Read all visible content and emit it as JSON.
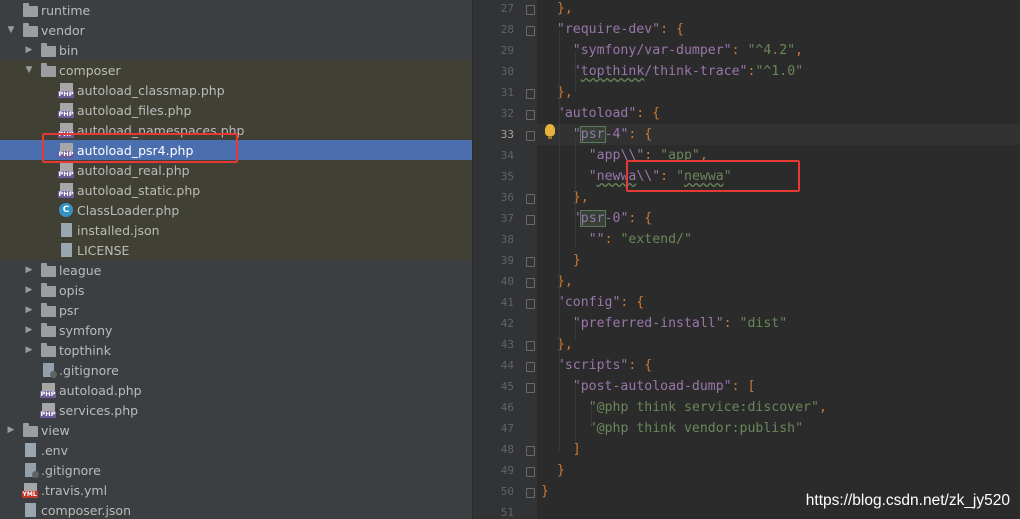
{
  "project_tree": {
    "items": [
      {
        "label": "runtime",
        "icon": "folder-icon",
        "expand": "none",
        "selected": false
      },
      {
        "label": "vendor",
        "icon": "folder-icon",
        "expand": "open",
        "selected": false
      },
      {
        "label": "bin",
        "icon": "folder-icon",
        "expand": "closed",
        "selected": false
      },
      {
        "label": "composer",
        "icon": "folder-icon",
        "expand": "open",
        "selected": false
      },
      {
        "label": "autoload_classmap.php",
        "icon": "php-file-icon",
        "expand": "none",
        "selected": false
      },
      {
        "label": "autoload_files.php",
        "icon": "php-file-icon",
        "expand": "none",
        "selected": false
      },
      {
        "label": "autoload_namespaces.php",
        "icon": "php-file-icon",
        "expand": "none",
        "selected": false
      },
      {
        "label": "autoload_psr4.php",
        "icon": "php-file-icon",
        "expand": "none",
        "selected": true
      },
      {
        "label": "autoload_real.php",
        "icon": "php-file-icon",
        "expand": "none",
        "selected": false
      },
      {
        "label": "autoload_static.php",
        "icon": "php-file-icon",
        "expand": "none",
        "selected": false
      },
      {
        "label": "ClassLoader.php",
        "icon": "php-class-icon",
        "expand": "none",
        "selected": false
      },
      {
        "label": "installed.json",
        "icon": "json-file-icon",
        "expand": "none",
        "selected": false
      },
      {
        "label": "LICENSE",
        "icon": "text-file-icon",
        "expand": "none",
        "selected": false
      },
      {
        "label": "league",
        "icon": "folder-icon",
        "expand": "closed",
        "selected": false
      },
      {
        "label": "opis",
        "icon": "folder-icon",
        "expand": "closed",
        "selected": false
      },
      {
        "label": "psr",
        "icon": "folder-icon",
        "expand": "closed",
        "selected": false
      },
      {
        "label": "symfony",
        "icon": "folder-icon",
        "expand": "closed",
        "selected": false
      },
      {
        "label": "topthink",
        "icon": "folder-icon",
        "expand": "closed",
        "selected": false
      },
      {
        "label": ".gitignore",
        "icon": "gitignore-file-icon",
        "expand": "none",
        "selected": false
      },
      {
        "label": "autoload.php",
        "icon": "php-file-icon",
        "expand": "none",
        "selected": false
      },
      {
        "label": "services.php",
        "icon": "php-file-icon",
        "expand": "none",
        "selected": false
      },
      {
        "label": "view",
        "icon": "folder-icon",
        "expand": "closed",
        "selected": false
      },
      {
        "label": ".env",
        "icon": "text-file-icon",
        "expand": "none",
        "selected": false
      },
      {
        "label": ".gitignore",
        "icon": "gitignore-file-icon",
        "expand": "none",
        "selected": false
      },
      {
        "label": ".travis.yml",
        "icon": "yml-file-icon",
        "expand": "none",
        "selected": false
      },
      {
        "label": "composer.json",
        "icon": "json-file-icon",
        "expand": "none",
        "selected": false
      }
    ]
  },
  "editor": {
    "current_line": "33",
    "lines": [
      {
        "num": "27",
        "tokens": [
          {
            "t": "},",
            "c": "p"
          }
        ]
      },
      {
        "num": "28",
        "tokens": [
          {
            "t": "\"require-dev\"",
            "c": "k"
          },
          {
            "t": ": {",
            "c": "p"
          }
        ]
      },
      {
        "num": "29",
        "tokens": [
          {
            "t": "\"symfony/var-dumper\"",
            "c": "k"
          },
          {
            "t": ": ",
            "c": "p"
          },
          {
            "t": "\"^4.2\"",
            "c": "s"
          },
          {
            "t": ",",
            "c": "p"
          }
        ]
      },
      {
        "num": "30",
        "tokens": [
          {
            "t": "\"",
            "c": "k"
          },
          {
            "t": "topthink",
            "c": "k typo"
          },
          {
            "t": "/think-trace\"",
            "c": "k"
          },
          {
            "t": ":",
            "c": "p"
          },
          {
            "t": "\"^1.0\"",
            "c": "s"
          }
        ]
      },
      {
        "num": "31",
        "tokens": [
          {
            "t": "},",
            "c": "p"
          }
        ]
      },
      {
        "num": "32",
        "tokens": [
          {
            "t": "\"autoload\"",
            "c": "k"
          },
          {
            "t": ": {",
            "c": "p"
          }
        ]
      },
      {
        "num": "33",
        "tokens": [
          {
            "t": "\"",
            "c": "k"
          },
          {
            "t": "psr",
            "c": "k hl"
          },
          {
            "t": "-4\"",
            "c": "k"
          },
          {
            "t": ": {",
            "c": "p"
          }
        ]
      },
      {
        "num": "34",
        "tokens": [
          {
            "t": "\"app\\\\\"",
            "c": "k"
          },
          {
            "t": ": ",
            "c": "p"
          },
          {
            "t": "\"app\"",
            "c": "s"
          },
          {
            "t": ",",
            "c": "p"
          }
        ]
      },
      {
        "num": "35",
        "tokens": [
          {
            "t": "\"",
            "c": "k"
          },
          {
            "t": "newwa",
            "c": "k typo"
          },
          {
            "t": "\\\\\"",
            "c": "k"
          },
          {
            "t": ": ",
            "c": "p"
          },
          {
            "t": "\"",
            "c": "s"
          },
          {
            "t": "newwa",
            "c": "s typo"
          },
          {
            "t": "\"",
            "c": "s"
          }
        ]
      },
      {
        "num": "36",
        "tokens": [
          {
            "t": "},",
            "c": "p"
          }
        ]
      },
      {
        "num": "37",
        "tokens": [
          {
            "t": "\"",
            "c": "k"
          },
          {
            "t": "psr",
            "c": "k hl"
          },
          {
            "t": "-0\"",
            "c": "k"
          },
          {
            "t": ": {",
            "c": "p"
          }
        ]
      },
      {
        "num": "38",
        "tokens": [
          {
            "t": "\"\"",
            "c": "k"
          },
          {
            "t": ": ",
            "c": "p"
          },
          {
            "t": "\"extend/\"",
            "c": "s"
          }
        ]
      },
      {
        "num": "39",
        "tokens": [
          {
            "t": "}",
            "c": "p"
          }
        ]
      },
      {
        "num": "40",
        "tokens": [
          {
            "t": "},",
            "c": "p"
          }
        ]
      },
      {
        "num": "41",
        "tokens": [
          {
            "t": "\"config\"",
            "c": "k"
          },
          {
            "t": ": {",
            "c": "p"
          }
        ]
      },
      {
        "num": "42",
        "tokens": [
          {
            "t": "\"preferred-install\"",
            "c": "k"
          },
          {
            "t": ": ",
            "c": "p"
          },
          {
            "t": "\"dist\"",
            "c": "s"
          }
        ]
      },
      {
        "num": "43",
        "tokens": [
          {
            "t": "},",
            "c": "p"
          }
        ]
      },
      {
        "num": "44",
        "tokens": [
          {
            "t": "\"scripts\"",
            "c": "k"
          },
          {
            "t": ": {",
            "c": "p"
          }
        ]
      },
      {
        "num": "45",
        "tokens": [
          {
            "t": "\"post-autoload-dump\"",
            "c": "k"
          },
          {
            "t": ": [",
            "c": "p"
          }
        ]
      },
      {
        "num": "46",
        "tokens": [
          {
            "t": "\"@php think service:discover\"",
            "c": "s"
          },
          {
            "t": ",",
            "c": "p"
          }
        ]
      },
      {
        "num": "47",
        "tokens": [
          {
            "t": "\"@php think vendor:publish\"",
            "c": "s"
          }
        ]
      },
      {
        "num": "48",
        "tokens": [
          {
            "t": "]",
            "c": "p"
          }
        ]
      },
      {
        "num": "49",
        "tokens": [
          {
            "t": "}",
            "c": "p"
          }
        ]
      },
      {
        "num": "50",
        "tokens": [
          {
            "t": "}",
            "c": "p"
          }
        ]
      },
      {
        "num": "51",
        "tokens": []
      }
    ]
  },
  "watermark": "https://blog.csdn.net/zk_jy520",
  "colors": {
    "selection": "#4b6eaf",
    "highlight_box": "#e53935",
    "key": "#9876aa",
    "string": "#6a8759"
  }
}
